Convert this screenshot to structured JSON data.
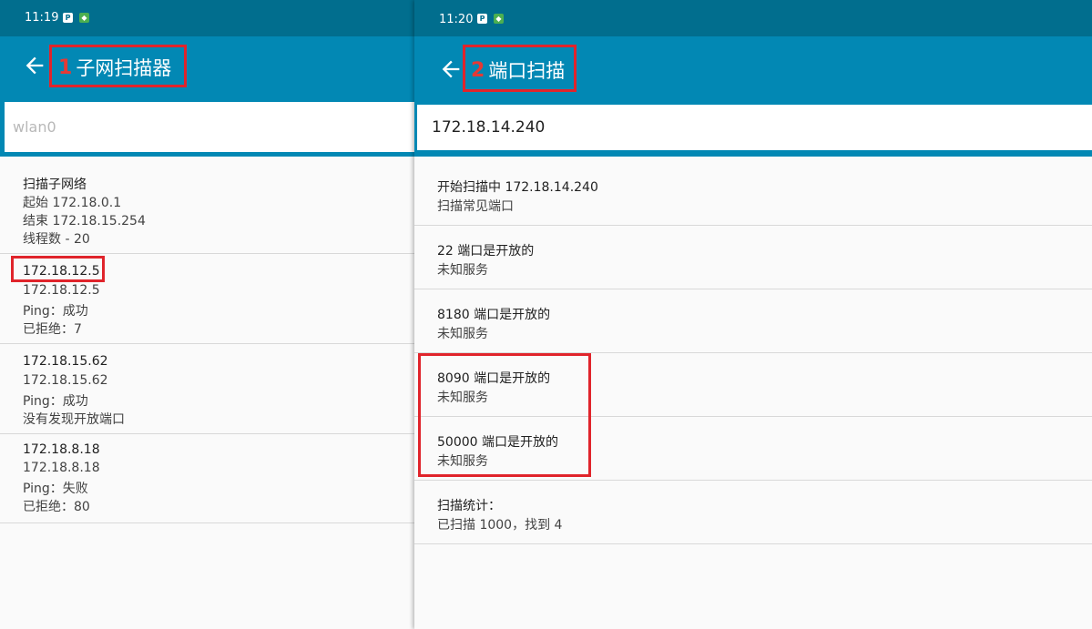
{
  "left": {
    "status": {
      "time": "11:19"
    },
    "step_number": "1",
    "title": "子网扫描器",
    "search_placeholder": "wlan0",
    "items": [
      {
        "title": "扫描子网络",
        "lines": [
          "起始 172.18.0.1",
          "结束 172.18.15.254",
          "线程数 - 20"
        ]
      },
      {
        "title": "172.18.12.5",
        "lines": [
          "172.18.12.5",
          "Ping：成功",
          "已拒绝：7"
        ]
      },
      {
        "title": "172.18.15.62",
        "lines": [
          "172.18.15.62",
          "Ping：成功",
          "没有发现开放端口"
        ]
      },
      {
        "title": "172.18.8.18",
        "lines": [
          "172.18.8.18",
          "Ping：失败",
          "已拒绝：80"
        ]
      }
    ]
  },
  "right": {
    "status": {
      "time": "11:20"
    },
    "step_number": "2",
    "title": "端口扫描",
    "search_value": "172.18.14.240",
    "items": [
      {
        "title": "开始扫描中 172.18.14.240",
        "sub": "扫描常见端口"
      },
      {
        "title": "22 端口是开放的",
        "sub": "未知服务"
      },
      {
        "title": "8180 端口是开放的",
        "sub": "未知服务"
      },
      {
        "title": "8090 端口是开放的",
        "sub": "未知服务"
      },
      {
        "title": "50000 端口是开放的",
        "sub": "未知服务"
      },
      {
        "title": "扫描统计：",
        "sub": "已扫描 1000，找到 4"
      }
    ]
  },
  "status_icons": {
    "p_label": "P"
  },
  "colors": {
    "status_bar": "#016e8e",
    "app_bar": "#0288b4",
    "highlight": "#e0242b"
  }
}
